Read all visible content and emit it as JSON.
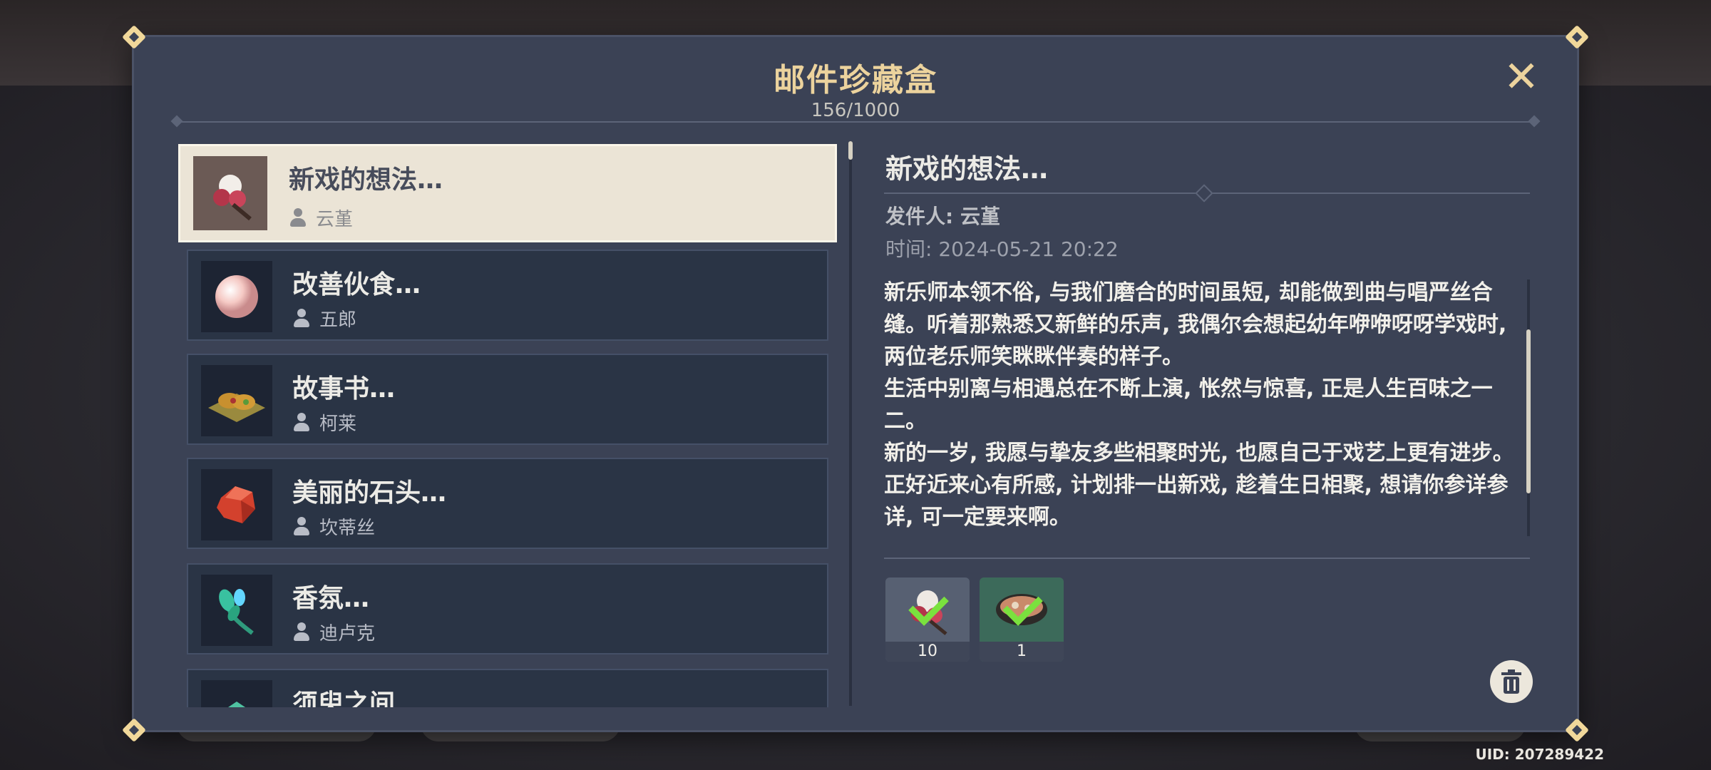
{
  "modal": {
    "title": "邮件珍藏盒",
    "count": "156/1000",
    "close_label": "✕"
  },
  "mail_list": [
    {
      "title": "新戏的想法…",
      "sender": "云堇",
      "icon": "flower-bouquet-icon",
      "selected": true
    },
    {
      "title": "改善伙食…",
      "sender": "五郎",
      "icon": "pearl-icon",
      "selected": false
    },
    {
      "title": "故事书…",
      "sender": "柯莱",
      "icon": "food-plate-icon",
      "selected": false
    },
    {
      "title": "美丽的石头…",
      "sender": "坎蒂丝",
      "icon": "red-gem-icon",
      "selected": false
    },
    {
      "title": "香氛…",
      "sender": "迪卢克",
      "icon": "blue-flower-icon",
      "selected": false
    },
    {
      "title": "须臾之间…",
      "sender": "",
      "icon": "green-leaf-icon",
      "selected": false
    }
  ],
  "detail": {
    "title": "新戏的想法…",
    "sender_line": "发件人: 云堇",
    "time_line": "时间: 2024-05-21 20:22",
    "paragraphs": [
      "新乐师本领不俗, 与我们磨合的时间虽短, 却能做到曲与唱严丝合缝。听着那熟悉又新鲜的乐声, 我偶尔会想起幼年咿咿呀呀学戏时, 两位老乐师笑眯眯伴奏的样子。",
      "生活中别离与相遇总在不断上演, 怅然与惊喜, 正是人生百味之一二。",
      "新的一岁, 我愿与挚友多些相聚时光, 也愿自己于戏艺上更有进步。正好近来心有所感, 计划排一出新戏, 趁着生日相聚, 想请你参详参详, 可一定要来啊。"
    ],
    "attachments": [
      {
        "icon": "flower-bouquet-icon",
        "quantity": "10",
        "claimed": true
      },
      {
        "icon": "soup-bowl-icon",
        "quantity": "1",
        "claimed": true
      }
    ]
  },
  "footer": {
    "uid": "UID: 207289422"
  },
  "colors": {
    "accent_gold": "#ecd39d",
    "panel_bg": "#3b4255",
    "item_bg": "#2a3445",
    "selected_bg": "#ebe4d6",
    "check_green": "#7ae13e"
  }
}
